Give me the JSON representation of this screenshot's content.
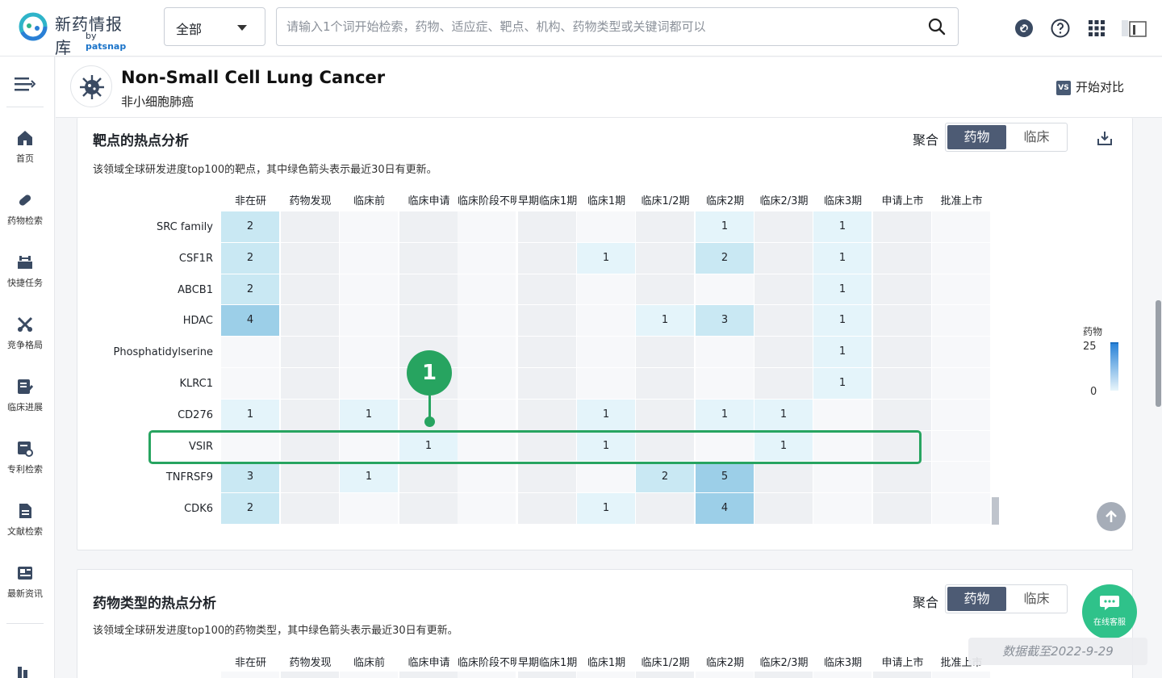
{
  "app": {
    "name": "新药情报库",
    "by": "by",
    "by_brand": "patsnap"
  },
  "search": {
    "scope": "全部",
    "placeholder": "请输入1个词开始检索，药物、适应症、靶点、机构、药物类型或关键词都可以"
  },
  "sidebar": {
    "items": [
      {
        "label": "首页",
        "icon": "home-icon"
      },
      {
        "label": "药物检索",
        "icon": "pill-icon"
      },
      {
        "label": "快捷任务",
        "icon": "task-icon"
      },
      {
        "label": "竞争格局",
        "icon": "competition-icon"
      },
      {
        "label": "临床进展",
        "icon": "clinical-icon"
      },
      {
        "label": "专利检索",
        "icon": "patent-icon"
      },
      {
        "label": "文献检索",
        "icon": "document-icon"
      },
      {
        "label": "最新资讯",
        "icon": "news-icon"
      }
    ]
  },
  "header": {
    "title_en": "Non-Small Cell Lung Cancer",
    "title_zh": "非小细胞肺癌",
    "compare_badge": "VS",
    "compare_label": "开始对比"
  },
  "target_section": {
    "title": "靶点的热点分析",
    "desc": "该领域全球研发进度top100的靶点，其中绿色箭头表示最近30日有更新。",
    "agg_label": "聚合",
    "toggle_on": "药物",
    "toggle_off": "临床"
  },
  "drugtype_section": {
    "title": "药物类型的热点分析",
    "desc": "该领域全球研发进度top100的药物类型，其中绿色箭头表示最近30日有更新。",
    "agg_label": "聚合",
    "toggle_on": "药物",
    "toggle_off": "临床"
  },
  "columns": [
    "非在研",
    "药物发现",
    "临床前",
    "临床申请",
    "临床阶段不明",
    "早期临床1期",
    "临床1期",
    "临床1/2期",
    "临床2期",
    "临床2/3期",
    "临床3期",
    "申请上市",
    "批准上市"
  ],
  "heatmap": {
    "rows": [
      {
        "label": "SRC family",
        "values": [
          2,
          null,
          null,
          null,
          null,
          null,
          null,
          null,
          1,
          null,
          1,
          null,
          null
        ]
      },
      {
        "label": "CSF1R",
        "values": [
          2,
          null,
          null,
          null,
          null,
          null,
          1,
          null,
          2,
          null,
          1,
          null,
          null
        ]
      },
      {
        "label": "ABCB1",
        "values": [
          2,
          null,
          null,
          null,
          null,
          null,
          null,
          null,
          null,
          null,
          1,
          null,
          null
        ]
      },
      {
        "label": "HDAC",
        "values": [
          4,
          null,
          null,
          null,
          null,
          null,
          null,
          1,
          3,
          null,
          1,
          null,
          null
        ]
      },
      {
        "label": "Phosphatidylserine",
        "values": [
          null,
          null,
          null,
          null,
          null,
          null,
          null,
          null,
          null,
          null,
          1,
          null,
          null
        ]
      },
      {
        "label": "KLRC1",
        "values": [
          null,
          null,
          null,
          null,
          null,
          null,
          null,
          null,
          null,
          null,
          1,
          null,
          null
        ]
      },
      {
        "label": "CD276",
        "values": [
          1,
          null,
          1,
          null,
          null,
          null,
          1,
          null,
          1,
          1,
          null,
          null,
          null
        ]
      },
      {
        "label": "VSIR",
        "values": [
          null,
          null,
          null,
          1,
          null,
          null,
          1,
          null,
          null,
          1,
          null,
          null,
          null
        ]
      },
      {
        "label": "TNFRSF9",
        "values": [
          3,
          null,
          1,
          null,
          null,
          null,
          null,
          2,
          5,
          null,
          null,
          null,
          null
        ]
      },
      {
        "label": "CDK6",
        "values": [
          2,
          null,
          null,
          null,
          null,
          null,
          1,
          null,
          4,
          null,
          null,
          null,
          null
        ]
      }
    ],
    "legend_title": "药物",
    "legend_max": "25",
    "legend_min": "0",
    "max_value": 25,
    "colors": {
      "low": "#e4f4fa",
      "mid": "#c9e8f3",
      "high": "#9ccfe8",
      "empty": "#f7f8fa",
      "empty_alt": "#eef0f3"
    }
  },
  "annotation": {
    "number": "1"
  },
  "chat": {
    "label": "在线客服"
  },
  "data_date": "数据截至2022-9-29",
  "colors": {
    "accent": "#27a460",
    "toggle_active": "#4d5b74",
    "brand": "#1a73c9"
  }
}
